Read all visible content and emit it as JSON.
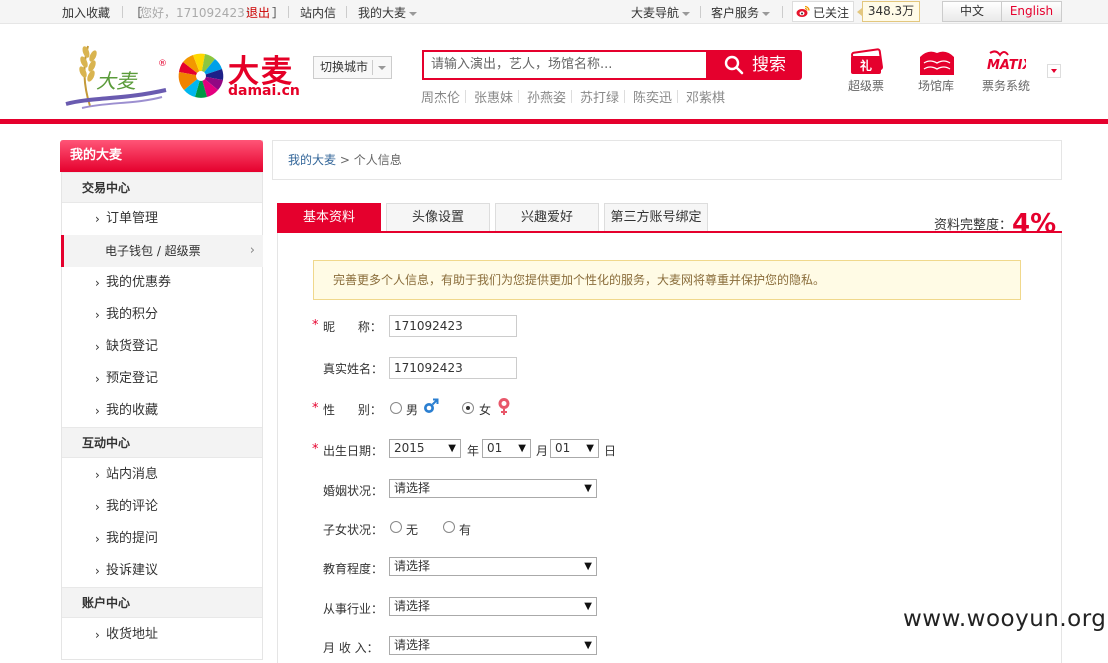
{
  "topbar": {
    "favorite": "加入收藏",
    "bracket_open": "［",
    "greeting": "您好，171092423！",
    "logout": "退出",
    "bracket_close": "］",
    "inbox": "站内信",
    "my_damai": "我的大麦",
    "nav": "大麦导航",
    "service": "客户服务",
    "weibo_follow": "已关注",
    "fans_count": "348.3万",
    "lang_zh": "中文",
    "lang_en": "English"
  },
  "header": {
    "logo_text": "大麦",
    "logo_domain": "damai.cn",
    "city_switch": "切换城市",
    "search_placeholder": "请输入演出，艺人，场馆名称...",
    "search_button": "搜索",
    "hot_keywords": [
      "周杰伦",
      "张惠妹",
      "孙燕姿",
      "苏打绿",
      "陈奕迅",
      "邓紫棋"
    ],
    "quick_links": [
      "超级票",
      "场馆库",
      "票务系统"
    ]
  },
  "sidebar": {
    "title": "我的大麦",
    "groups": [
      {
        "title": "交易中心"
      },
      {
        "title": "互动中心"
      },
      {
        "title": "账户中心"
      }
    ],
    "items": {
      "orders": "订单管理",
      "wallet": "电子钱包 / 超级票",
      "coupons": "我的优惠券",
      "points": "我的积分",
      "stockout": "缺货登记",
      "reserve": "预定登记",
      "favorites": "我的收藏",
      "messages": "站内消息",
      "comments": "我的评论",
      "questions": "我的提问",
      "complaints": "投诉建议",
      "address": "收货地址"
    },
    "arrow": "›"
  },
  "breadcrumb": {
    "root": "我的大麦",
    "sep": " > ",
    "current": "个人信息"
  },
  "tabs": [
    "基本资料",
    "头像设置",
    "兴趣爱好",
    "第三方账号绑定"
  ],
  "completion": {
    "label": "资料完整度：",
    "value": "4%"
  },
  "notice": "完善更多个人信息，有助于我们为您提供更加个性化的服务，大麦网将尊重并保护您的隐私。",
  "form": {
    "required_mark": "*",
    "nickname_label": "昵      称：",
    "nickname_value": "171092423",
    "realname_label": "真实姓名：",
    "realname_value": "171092423",
    "gender_label": "性      别：",
    "gender_male": "男",
    "gender_female": "女",
    "gender_selected": "女",
    "birthday_label": "出生日期：",
    "birth_year": "2015",
    "birth_year_unit": "年",
    "birth_month": "01",
    "birth_month_unit": "月",
    "birth_day": "01",
    "birth_day_unit": "日",
    "marital_label": "婚姻状况：",
    "children_label": "子女状况：",
    "children_no": "无",
    "children_yes": "有",
    "education_label": "教育程度：",
    "industry_label": "从事行业：",
    "income_label": "月 收 入：",
    "please_select": "请选择",
    "dropdown_arrow": "▼"
  },
  "watermark": "www.wooyun.org",
  "colors": {
    "brand_red": "#e5002d",
    "link_blue": "#336699",
    "notice_bg": "#fffbe5"
  }
}
